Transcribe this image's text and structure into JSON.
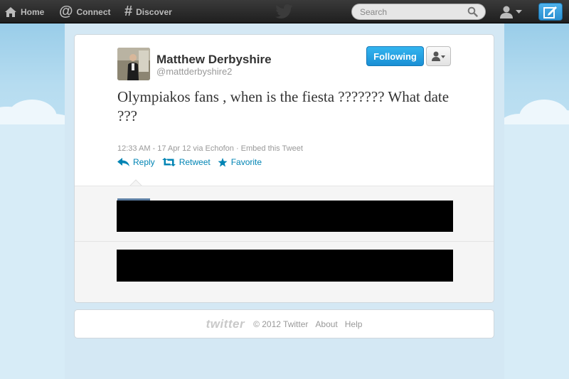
{
  "topbar": {
    "nav": [
      {
        "label": "Home",
        "icon": "home-icon"
      },
      {
        "label": "Connect",
        "icon": "at-icon"
      },
      {
        "label": "Discover",
        "icon": "hash-icon"
      }
    ],
    "search_placeholder": "Search"
  },
  "tweet": {
    "author_name": "Matthew Derbyshire",
    "author_handle": "@mattderbyshire2",
    "follow_label": "Following",
    "text": "Olympiakos fans , when is the fiesta ??????? What date ???",
    "meta": "12:33 AM - 17 Apr 12 via Echofon · Embed this Tweet",
    "actions": {
      "reply": "Reply",
      "retweet": "Retweet",
      "favorite": "Favorite"
    }
  },
  "footer": {
    "logo": "twitter",
    "copyright": "© 2012 Twitter",
    "about": "About",
    "help": "Help"
  },
  "colors": {
    "topbar": "#222222",
    "link": "#0084b4",
    "follow_button": "#2aa3e3",
    "background": "#c0deed"
  }
}
